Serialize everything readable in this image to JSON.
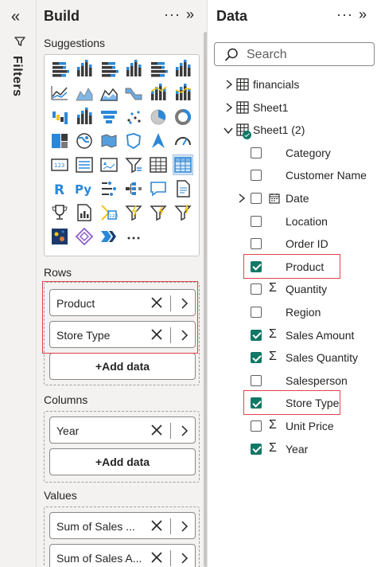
{
  "filters": {
    "label": "Filters",
    "collapse_icon": "double-chevron-left-icon",
    "icon": "filter-icon"
  },
  "build": {
    "title": "Build",
    "more": "···",
    "expand_icon": "double-chevron-right-icon",
    "suggestions_label": "Suggestions",
    "viz_icons": [
      "stacked-bar-icon",
      "stacked-column-icon",
      "clustered-bar-icon",
      "clustered-column-icon",
      "100-stacked-bar-icon",
      "100-stacked-column-icon",
      "line-chart-icon",
      "area-chart-icon",
      "stacked-area-icon",
      "ribbon-icon",
      "line-clustered-column-icon",
      "line-stacked-column-icon",
      "waterfall-icon",
      "funnel-combo-icon",
      "funnel-icon",
      "scatter-icon",
      "pie-icon",
      "donut-icon",
      "treemap-icon",
      "map-icon",
      "filled-map-icon",
      "shape-map-icon",
      "azure-map-icon",
      "gauge-icon",
      "card-icon",
      "multi-row-card-icon",
      "kpi-icon",
      "slicer-icon",
      "table-icon",
      "matrix-icon",
      "r-visual-icon",
      "python-visual-icon",
      "key-influencers-icon",
      "decomposition-tree-icon",
      "qa-icon",
      "smart-narrative-icon",
      "trophy-icon",
      "paginated-report-icon",
      "power-apps-icon",
      "power-automate-icon",
      "metrics-icon",
      "new-card-icon",
      "arcgis-icon",
      "diamond-icon",
      "chevron-flow-icon",
      "more-visuals-icon"
    ],
    "more_visuals": "···",
    "rows": {
      "label": "Rows",
      "fields": [
        {
          "label": "Product"
        },
        {
          "label": "Store Type"
        }
      ],
      "add": "+Add data"
    },
    "columns": {
      "label": "Columns",
      "fields": [
        {
          "label": "Year"
        }
      ],
      "add": "+Add data"
    },
    "values": {
      "label": "Values",
      "fields": [
        {
          "label": "Sum of Sales Quantity",
          "display": "Sum of Sales ..."
        },
        {
          "label": "Sum of Sales Amount",
          "display": "Sum of Sales A..."
        }
      ]
    }
  },
  "data": {
    "title": "Data",
    "more": "···",
    "expand_icon": "double-chevron-right-icon",
    "search_placeholder": "Search",
    "tables": [
      {
        "name": "financials",
        "expanded": false
      },
      {
        "name": "Sheet1",
        "expanded": false
      },
      {
        "name": "Sheet1 (2)",
        "expanded": true
      }
    ],
    "fields": [
      {
        "name": "Category",
        "checked": false,
        "kind": "text"
      },
      {
        "name": "Customer Name",
        "checked": false,
        "kind": "text"
      },
      {
        "name": "Date",
        "checked": false,
        "kind": "date"
      },
      {
        "name": "Location",
        "checked": false,
        "kind": "text"
      },
      {
        "name": "Order ID",
        "checked": false,
        "kind": "text"
      },
      {
        "name": "Product",
        "checked": true,
        "kind": "text"
      },
      {
        "name": "Quantity",
        "checked": false,
        "kind": "sum"
      },
      {
        "name": "Region",
        "checked": false,
        "kind": "text"
      },
      {
        "name": "Sales Amount",
        "checked": true,
        "kind": "sum"
      },
      {
        "name": "Sales Quantity",
        "checked": true,
        "kind": "sum"
      },
      {
        "name": "Salesperson",
        "checked": false,
        "kind": "text"
      },
      {
        "name": "Store Type",
        "checked": true,
        "kind": "text"
      },
      {
        "name": "Unit Price",
        "checked": false,
        "kind": "sum"
      },
      {
        "name": "Year",
        "checked": true,
        "kind": "sum"
      }
    ]
  },
  "colors": {
    "accent": "#117865",
    "highlight": "#e0424b",
    "pane_bg": "#f3f2f1"
  }
}
